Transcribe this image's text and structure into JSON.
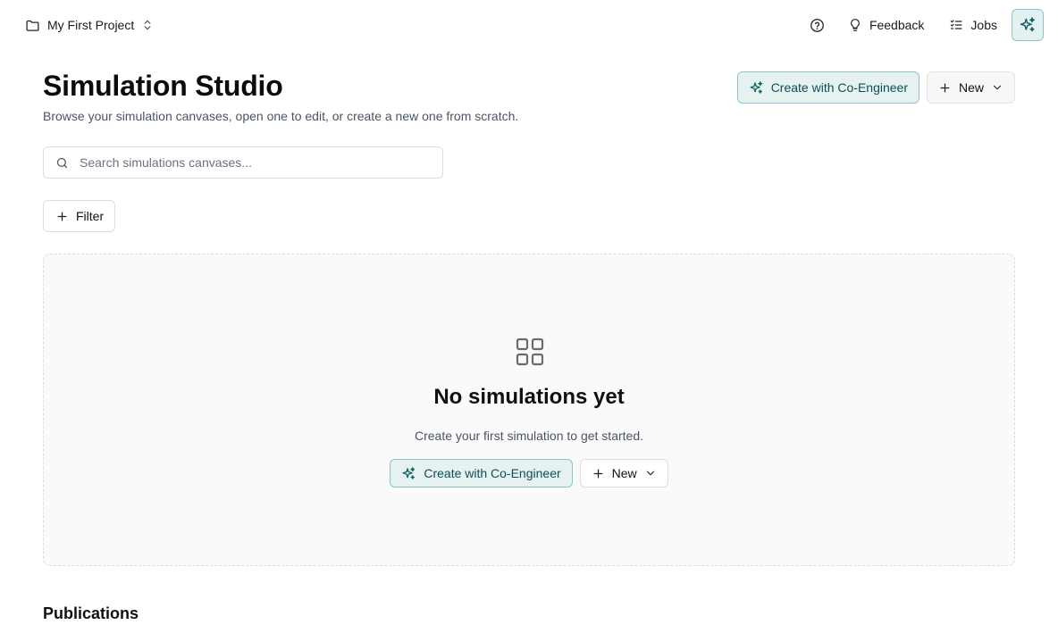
{
  "topbar": {
    "project_name": "My First Project",
    "feedback_label": "Feedback",
    "jobs_label": "Jobs"
  },
  "header": {
    "title": "Simulation Studio",
    "subtitle": "Browse your simulation canvases, open one to edit, or create a new one from scratch.",
    "co_engineer_label": "Create with Co-Engineer",
    "new_label": "New"
  },
  "search": {
    "placeholder": "Search simulations canvases...",
    "value": ""
  },
  "filter": {
    "label": "Filter"
  },
  "empty_state": {
    "title": "No simulations yet",
    "description": "Create your first simulation to get started.",
    "co_engineer_label": "Create with Co-Engineer",
    "new_label": "New"
  },
  "sections": {
    "publications_title": "Publications"
  },
  "colors": {
    "accent": "#0f4f52",
    "accent_bg": "#e6f2f2",
    "accent_border": "#8fc3c5",
    "text_primary": "#111111",
    "text_secondary": "#4b5563"
  },
  "icons": {
    "project": "folder-icon",
    "project_switch": "chevron-up-down-icon",
    "help": "help-circle-icon",
    "feedback": "lightbulb-icon",
    "jobs": "checklist-icon",
    "ai_toggle": "sparkles-icon",
    "search": "search-icon",
    "add": "plus-icon",
    "dropdown": "chevron-down-icon",
    "empty": "grid-icon"
  }
}
